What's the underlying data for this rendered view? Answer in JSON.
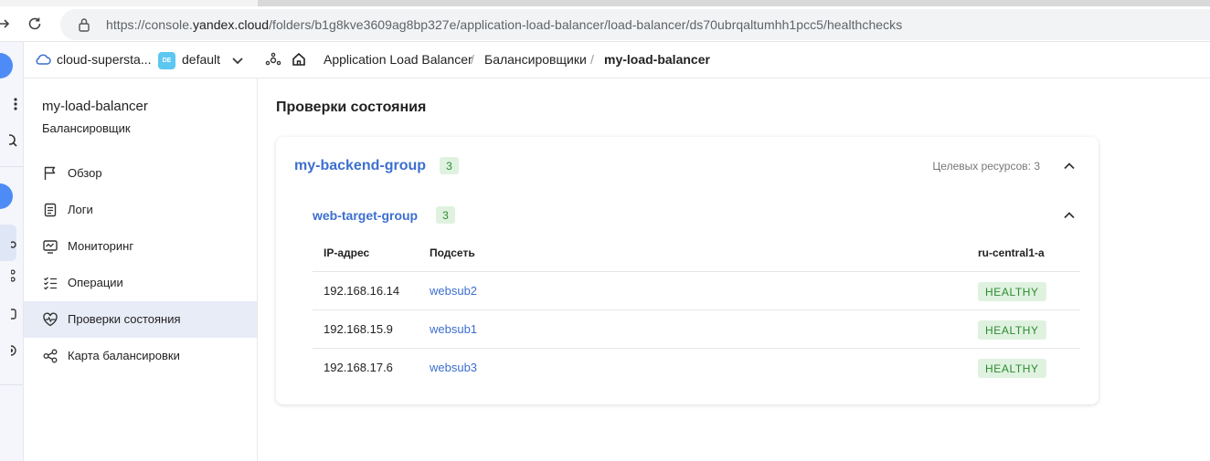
{
  "browser": {
    "url_prefix": "https://console.",
    "url_host": "yandex.cloud",
    "url_path": "/folders/b1g8kve3609ag8bp327e/application-load-balancer/load-balancer/ds70ubrqaltumhh1pcc5/healthchecks"
  },
  "header": {
    "cloud_name": "cloud-supersta...",
    "folder_badge": "DE",
    "folder_name": "default",
    "breadcrumbs": [
      "Application Load Balancer",
      "Балансировщики",
      "my-load-balancer"
    ],
    "separator": "/"
  },
  "sidebar": {
    "title": "my-load-balancer",
    "subtitle": "Балансировщик",
    "items": [
      {
        "label": "Обзор",
        "icon": "flag-icon"
      },
      {
        "label": "Логи",
        "icon": "logs-icon"
      },
      {
        "label": "Мониторинг",
        "icon": "monitoring-icon"
      },
      {
        "label": "Операции",
        "icon": "operations-icon"
      },
      {
        "label": "Проверки состояния",
        "icon": "heartbeat-icon",
        "active": true
      },
      {
        "label": "Карта балансировки",
        "icon": "map-icon"
      }
    ]
  },
  "main": {
    "title": "Проверки состояния",
    "backend_group": {
      "name": "my-backend-group",
      "count": "3",
      "targets_label": "Целевых ресурсов: 3"
    },
    "target_group": {
      "name": "web-target-group",
      "count": "3"
    },
    "table": {
      "columns": [
        "IP-адрес",
        "Подсеть",
        "ru-central1-a"
      ],
      "rows": [
        {
          "ip": "192.168.16.14",
          "subnet": "websub2",
          "status": "HEALTHY"
        },
        {
          "ip": "192.168.15.9",
          "subnet": "websub1",
          "status": "HEALTHY"
        },
        {
          "ip": "192.168.17.6",
          "subnet": "websub3",
          "status": "HEALTHY"
        }
      ]
    }
  },
  "colors": {
    "link": "#3d6fcf",
    "healthy_bg": "#dff2e0",
    "healthy_text": "#2d8b2f",
    "active_item": "#e8ecf7"
  }
}
